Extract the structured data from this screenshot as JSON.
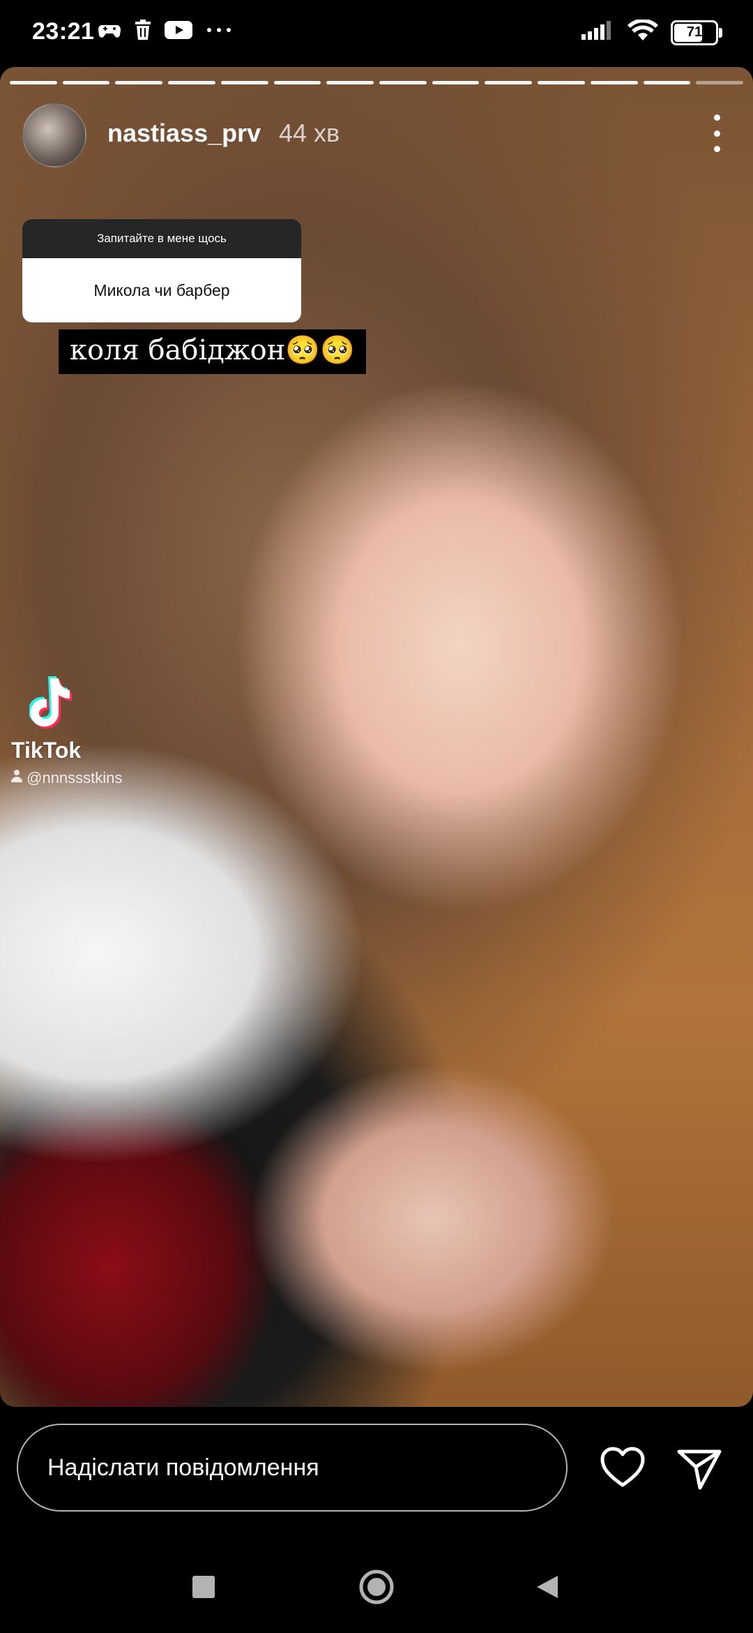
{
  "status_bar": {
    "time": "23:21",
    "battery": "71",
    "left_icons": [
      "gamepad-icon",
      "trash-icon",
      "youtube-icon",
      "more-dots-icon"
    ],
    "right_icons": [
      "signal-icon",
      "wifi-icon",
      "battery-icon"
    ]
  },
  "story": {
    "progress_segments": 14,
    "username": "nastiass_prv",
    "time_ago": "44 хв",
    "question_sticker": {
      "header": "Запитайте в мене щось",
      "answer": "Микола чи барбер"
    },
    "caption": "коля бабіджон🥺🥺",
    "tiktok": {
      "brand": "TikTok",
      "handle": "@nnnssstkins"
    }
  },
  "reply": {
    "placeholder": "Надіслати повідомлення"
  },
  "colors": {
    "background": "#000000",
    "tiktok_cyan": "#25F4EE",
    "tiktok_red": "#FE2C55"
  }
}
